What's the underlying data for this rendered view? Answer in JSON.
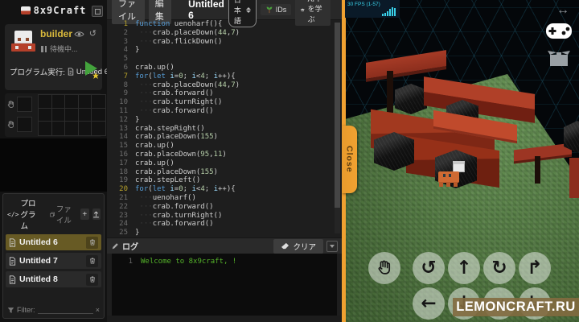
{
  "app": {
    "logo_text": "8x9Craft"
  },
  "sidebar": {
    "robot_name": "builder",
    "status_text": "待機中...",
    "run_label": "プログラム実行:",
    "run_target": "Untitled 6",
    "tabs": {
      "program": "プログラム",
      "file": "ファイル",
      "program_icon_glyph": "</>"
    },
    "add_button": "+",
    "programs": [
      {
        "label": "Untitled 6",
        "selected": true
      },
      {
        "label": "Untitled 7",
        "selected": false
      },
      {
        "label": "Untitled 8",
        "selected": false
      }
    ],
    "filter_label": "Filter:",
    "filter_clear_glyph": "×"
  },
  "topbar": {
    "file_menu": "ファイル",
    "edit_menu": "編集",
    "title": "Untitled 6",
    "language": "日本語",
    "ids_label": "IDs",
    "api_label": "APIを学ぶ"
  },
  "editor": {
    "lines": [
      "function uenoharf(){",
      "    crab.placeDown(44,7)",
      "    crab.flickDown()",
      "}",
      "",
      "crab.up()",
      "for(let i=0; i<4; i++){",
      "    crab.placeDown(44,7)",
      "    crab.forward()",
      "    crab.turnRight()",
      "    crab.forward()",
      "}",
      "crab.stepRight()",
      "crab.placeDown(155)",
      "crab.up()",
      "crab.placeDown(95,11)",
      "crab.up()",
      "crab.placeDown(155)",
      "crab.stepLeft()",
      "for(let i=0; i<4; i++){",
      "    uenoharf()",
      "    crab.forward()",
      "    crab.turnRight()",
      "    crab.forward()",
      "}"
    ]
  },
  "log": {
    "title": "ログ",
    "clear_label": "クリア",
    "lines": [
      "Welcome to 8x9craft, !"
    ]
  },
  "game": {
    "fps_text": "30 FPS (1-57)",
    "close_label": "Close",
    "watermark": "LEMONCRAFT.RU",
    "resize_glyph": "↔",
    "controls": {
      "row1": [
        "hand",
        "rotate-ccw",
        "up",
        "rotate-cw",
        "turn-up"
      ],
      "row2": [
        "left",
        "down",
        "right",
        "turn-down"
      ]
    }
  },
  "colors": {
    "accent_orange": "#f0a131",
    "builder_yellow": "#d9b93c",
    "play_green": "#43a33c",
    "log_green": "#55b32a",
    "selected_item": "#675a24",
    "fps_cyan": "#3ad2ea"
  }
}
